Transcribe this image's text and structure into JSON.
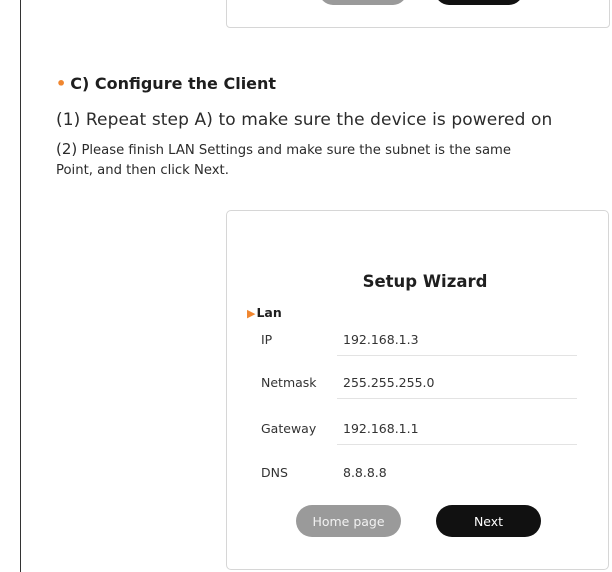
{
  "section": {
    "heading": "C) Configure the Client",
    "step1": "(1) Repeat step A) to make sure the device is powered on",
    "step2_num": "(2)",
    "step2_text": " Please finish LAN Settings and make sure the subnet is the same",
    "step2_cont": "Point, and then click Next."
  },
  "wizard": {
    "title": "Setup Wizard",
    "section_label": "Lan",
    "fields": [
      {
        "label": "IP",
        "value": "192.168.1.3"
      },
      {
        "label": "Netmask",
        "value": "255.255.255.0"
      },
      {
        "label": "Gateway",
        "value": "192.168.1.1"
      },
      {
        "label": "DNS",
        "value": "8.8.8.8"
      }
    ],
    "home_label": "Home page",
    "next_label": "Next"
  },
  "colors": {
    "accent": "#f0862f",
    "button_dark": "#111111",
    "button_gray": "#9a9a9a"
  }
}
